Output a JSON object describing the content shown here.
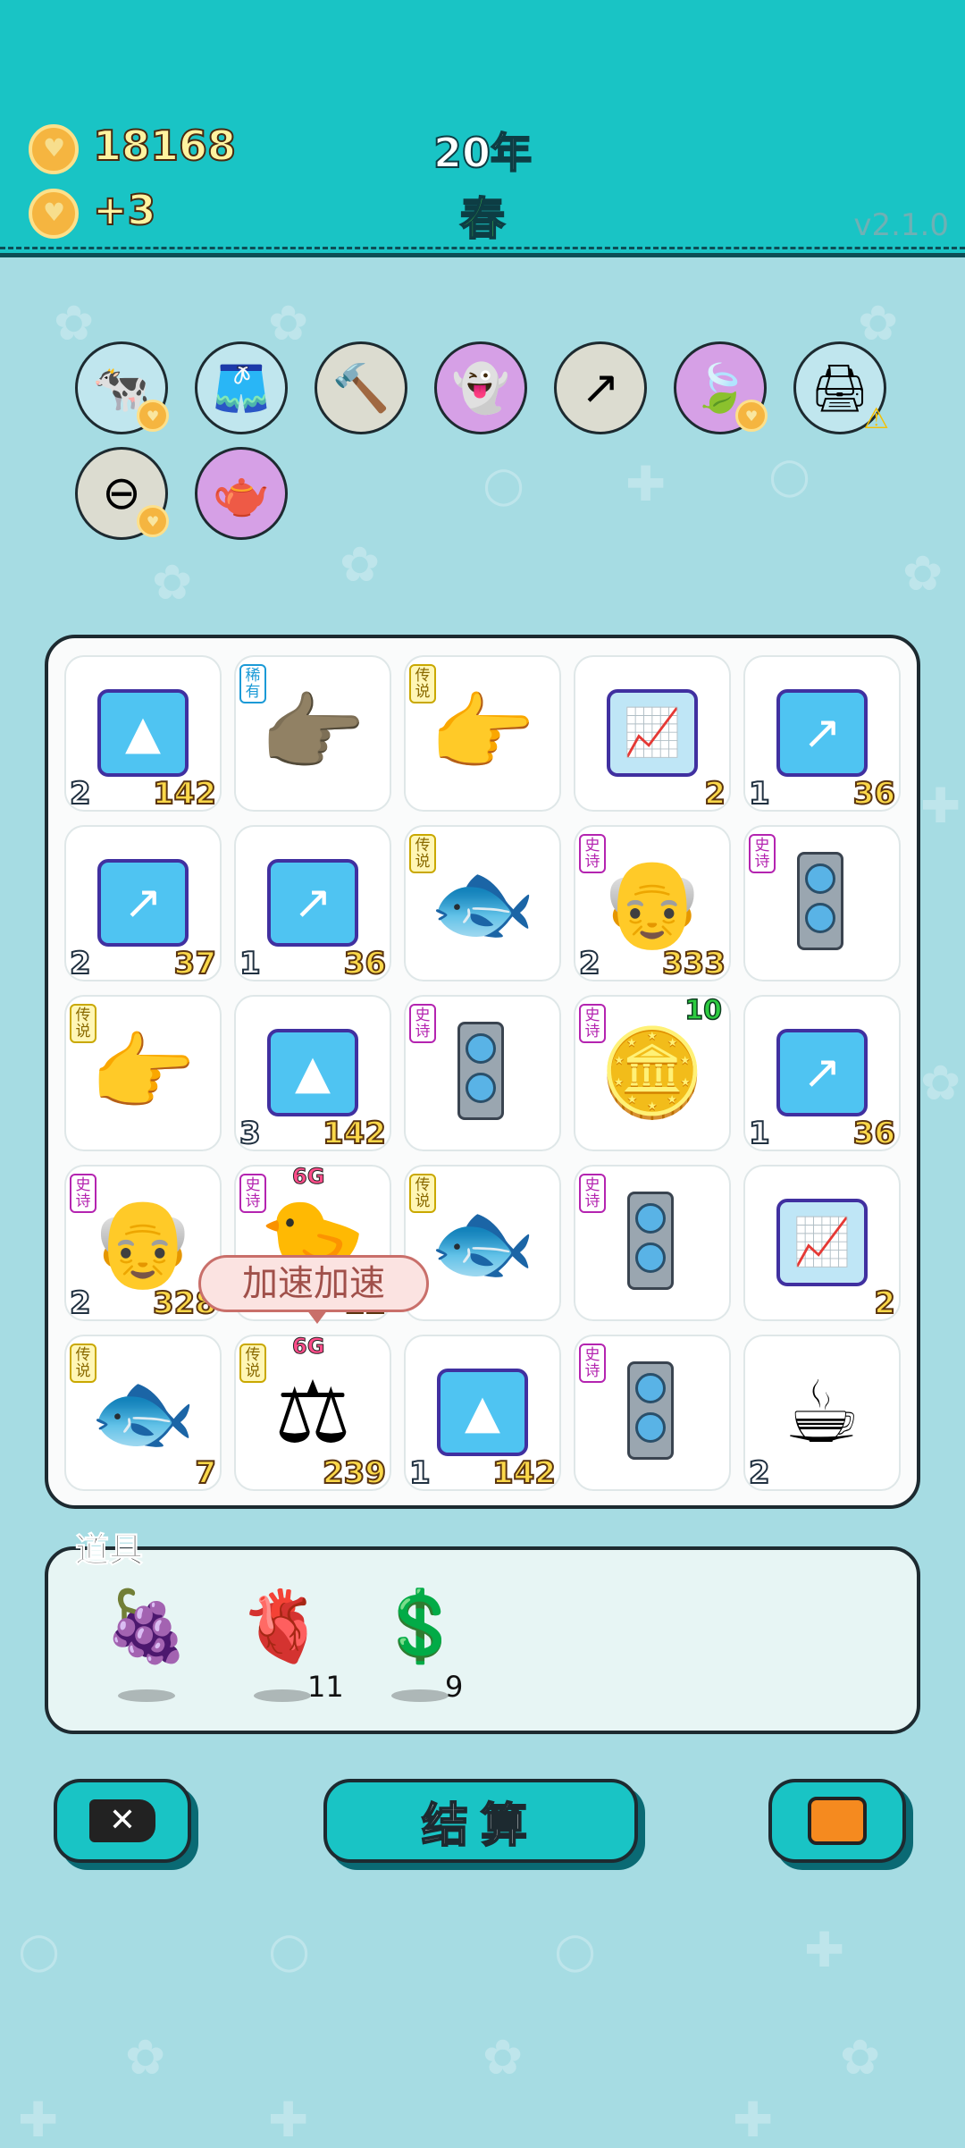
{
  "header": {
    "coins": "18168",
    "income": "+3",
    "year": "20年",
    "season": "春",
    "version": "v2.1.0"
  },
  "badges": [
    {
      "name": "cow-pair-badge",
      "glyph": "🐄",
      "bg": "#c0e6ee",
      "extra": "heart"
    },
    {
      "name": "skirt-badge",
      "glyph": "🩳",
      "bg": "#c0e6ee"
    },
    {
      "name": "hammer-badge",
      "glyph": "🔨",
      "bg": "#dcdcd0"
    },
    {
      "name": "ghost-badge",
      "glyph": "👻",
      "bg": "#d6a0e6"
    },
    {
      "name": "up-arrow-badge",
      "glyph": "↗",
      "bg": "#dcdcd0"
    },
    {
      "name": "leaf-badge",
      "glyph": "🍃",
      "bg": "#d6a0e6",
      "extra": "heart"
    },
    {
      "name": "printer-badge",
      "glyph": "🖨",
      "bg": "#c0e6ee",
      "extra": "warn"
    },
    {
      "name": "no-entry-badge",
      "glyph": "⊖",
      "bg": "#dcdcd0",
      "extra": "heart"
    },
    {
      "name": "gravy-boat-badge",
      "glyph": "🫖",
      "bg": "#d6a0e6"
    }
  ],
  "tags": {
    "rare": "稀有",
    "legend": "传说",
    "epic": "史诗"
  },
  "board": [
    [
      {
        "icon": "gold-bars",
        "left": "2",
        "right": "142"
      },
      {
        "icon": "pointing-hand-brown",
        "tag": "rare"
      },
      {
        "icon": "pointing-hand-yellow",
        "tag": "legend"
      },
      {
        "icon": "bar-chart-up",
        "right": "2"
      },
      {
        "icon": "trend-up",
        "left": "1",
        "right": "36"
      }
    ],
    [
      {
        "icon": "trend-up",
        "left": "2",
        "right": "37"
      },
      {
        "icon": "trend-up",
        "left": "1",
        "right": "36"
      },
      {
        "icon": "koi-fish",
        "tag": "legend"
      },
      {
        "icon": "old-man",
        "tag": "epic",
        "left": "2",
        "right": "333"
      },
      {
        "icon": "gpu",
        "tag": "epic"
      }
    ],
    [
      {
        "icon": "pointing-hand-yellow",
        "tag": "legend"
      },
      {
        "icon": "gold-bars",
        "left": "3",
        "right": "142"
      },
      {
        "icon": "gpu",
        "tag": "epic"
      },
      {
        "icon": "coin-chart",
        "tag": "epic",
        "top": "10"
      },
      {
        "icon": "trend-up",
        "left": "1",
        "right": "36"
      }
    ],
    [
      {
        "icon": "old-man",
        "tag": "epic",
        "left": "2",
        "right": "328"
      },
      {
        "icon": "chick",
        "tag": "epic",
        "right": "12"
      },
      {
        "icon": "koi-fish",
        "tag": "legend"
      },
      {
        "icon": "gpu",
        "tag": "epic"
      },
      {
        "icon": "bar-chart-up",
        "right": "2"
      }
    ],
    [
      {
        "icon": "koi-fish",
        "tag": "legend",
        "right": "7"
      },
      {
        "icon": "scales",
        "tag": "legend",
        "right": "239"
      },
      {
        "icon": "gold-bars",
        "left": "1",
        "right": "142"
      },
      {
        "icon": "gpu",
        "tag": "epic"
      },
      {
        "icon": "coffee-cup",
        "left": "2"
      }
    ]
  ],
  "overlay": {
    "six_g_top": "6G",
    "six_g_bottom": "6G",
    "bubble": "加速加速"
  },
  "props": {
    "title": "道具",
    "items": [
      {
        "name": "bayberry-icon",
        "glyph": "🍇",
        "count": ""
      },
      {
        "name": "liver-icon",
        "glyph": "🫀",
        "count": "11"
      },
      {
        "name": "dollar-coin-icon",
        "glyph": "💲",
        "count": "9"
      }
    ]
  },
  "buttons": {
    "settle": "结算"
  },
  "colors": {
    "teal": "#19c4c5",
    "background": "#a6dce3",
    "dark": "#1d2a30"
  }
}
